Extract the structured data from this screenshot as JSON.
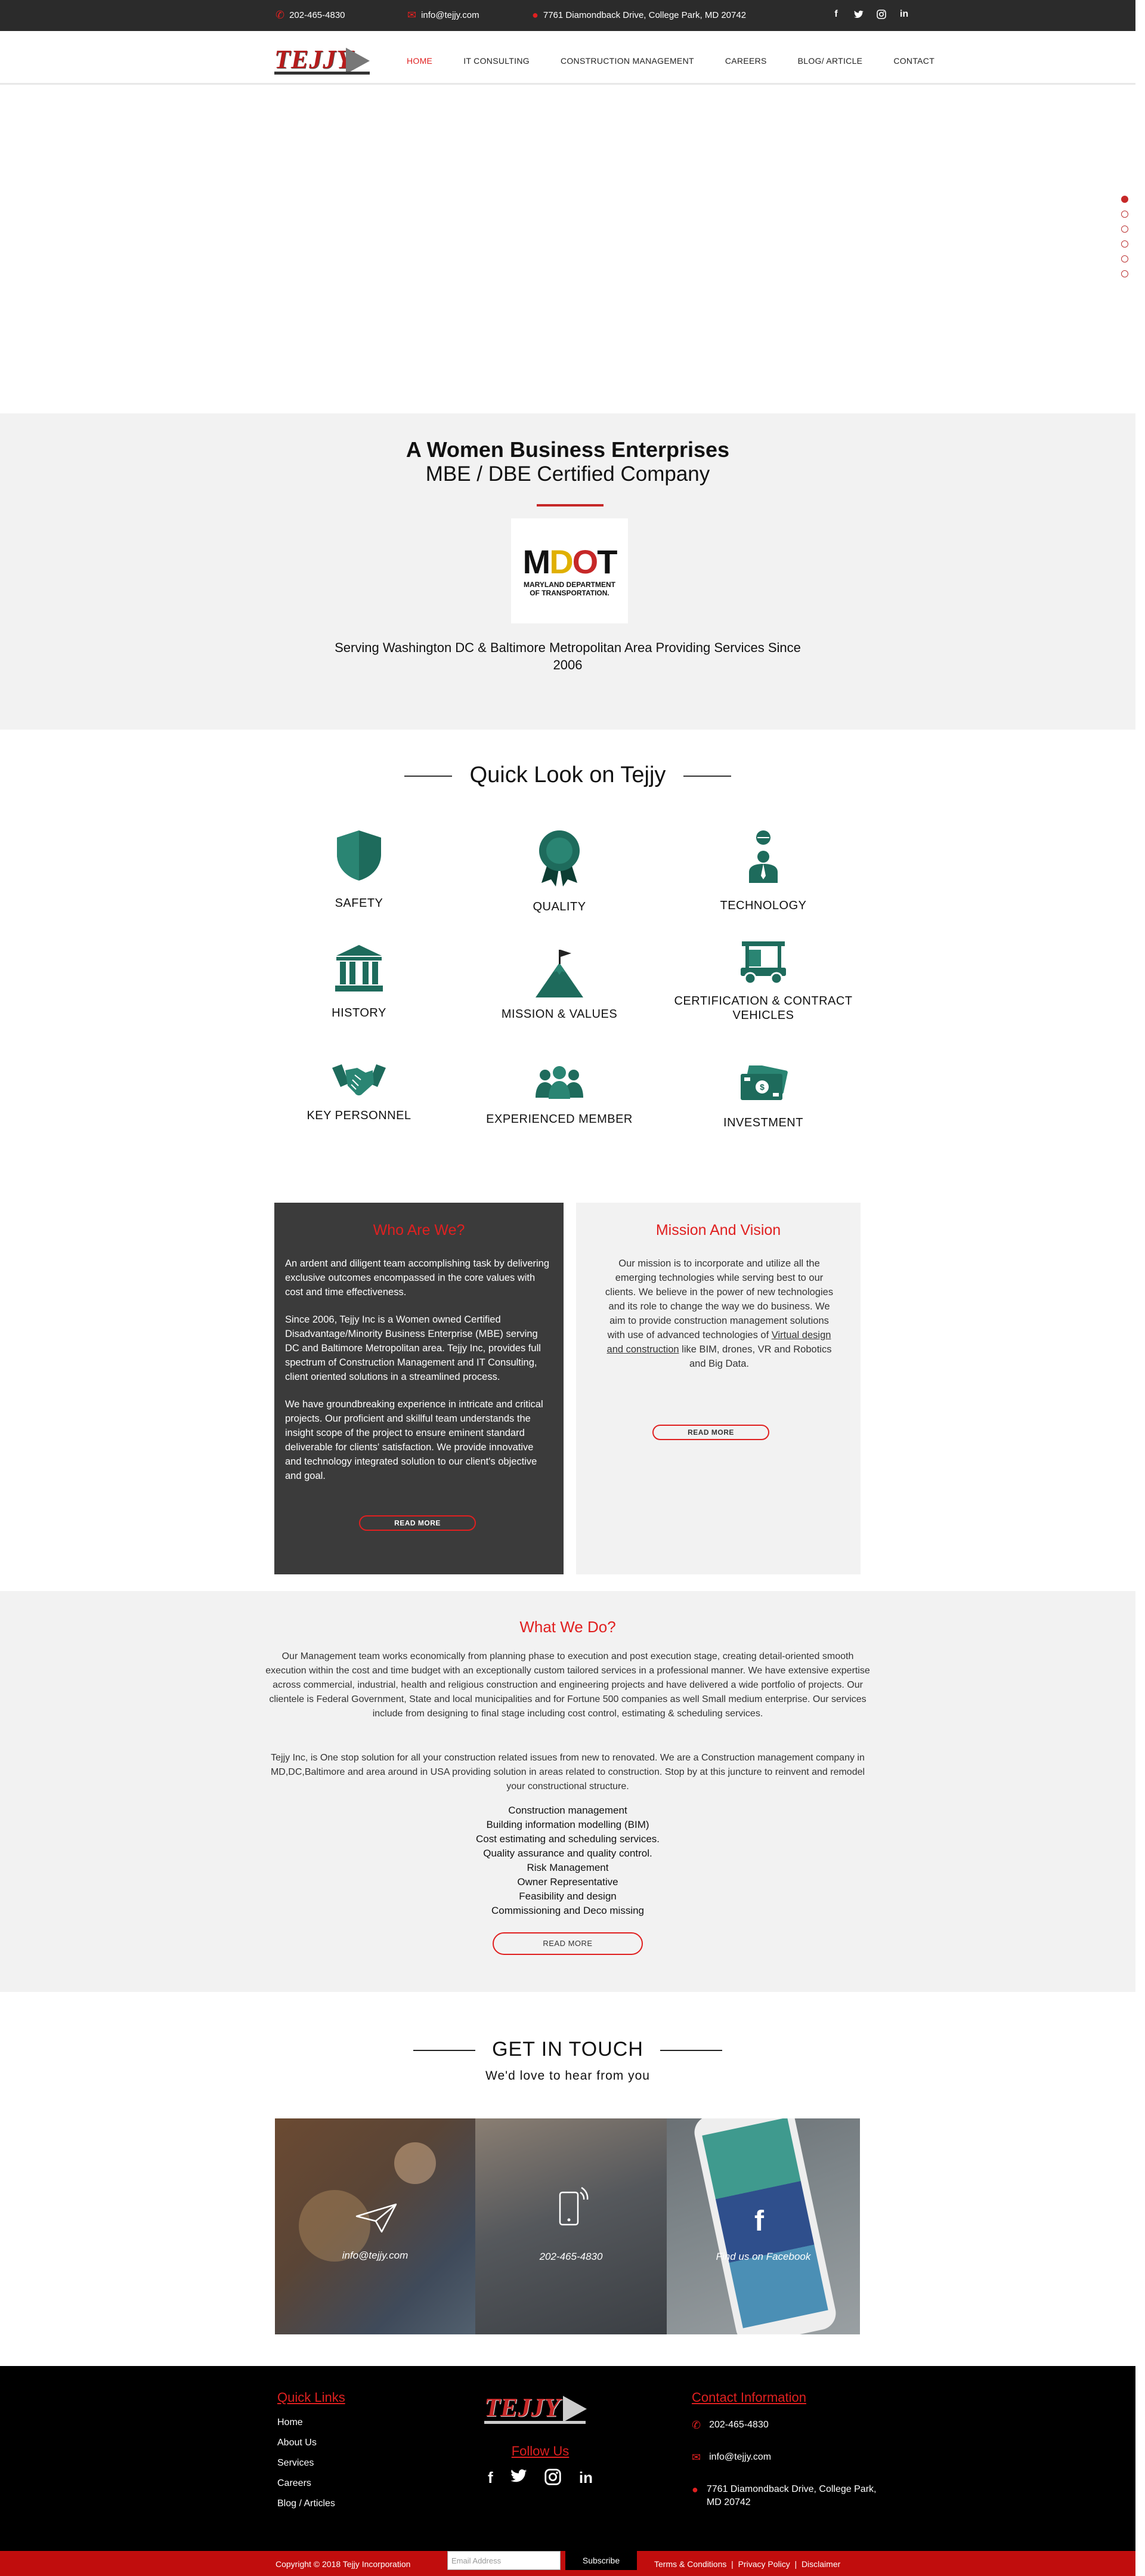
{
  "topbar": {
    "phone": "202-465-4830",
    "email": "info@tejjy.com",
    "address": "7761 Diamondback Drive, College Park, MD 20742",
    "social": [
      "facebook-icon",
      "twitter-icon",
      "instagram-icon",
      "linkedin-icon"
    ]
  },
  "nav": {
    "logo_text": "TEJJY",
    "items": [
      "HOME",
      "IT CONSULTING",
      "CONSTRUCTION MANAGEMENT",
      "CAREERS",
      "BLOG/ ARTICLE",
      "CONTACT"
    ],
    "active": "HOME"
  },
  "slider": {
    "slides": 6,
    "active_index": 0
  },
  "wbe": {
    "title": "A Women Business Enterprises",
    "subtitle": "MBE / DBE Certified Company",
    "mdot_logo": "MDOT",
    "mdot_line1": "MARYLAND DEPARTMENT",
    "mdot_line2": "OF TRANSPORTATION.",
    "serving": "Serving Washington DC & Baltimore Metropolitan Area Providing Services Since 2006"
  },
  "quicklook": {
    "title": "Quick Look on Tejjy",
    "items": [
      "SAFETY",
      "QUALITY",
      "TECHNOLOGY",
      "HISTORY",
      "MISSION & VALUES",
      "CERTIFICATION & CONTRACT VEHICLES",
      "KEY PERSONNEL",
      "EXPERIENCED MEMBER",
      "INVESTMENT"
    ]
  },
  "who": {
    "title": "Who Are We?",
    "p1": "An ardent and diligent team accomplishing task by delivering exclusive outcomes encompassed in the core values with cost and time effectiveness.",
    "p2": "Since 2006, Tejjy Inc is a Women owned Certified Disadvantage/Minority Business Enterprise (MBE) serving DC and Baltimore Metropolitan area. Tejjy Inc, provides full spectrum of Construction Management and IT Consulting,  client oriented solutions in a streamlined process.",
    "p3": "We have groundbreaking experience in intricate and critical projects. Our proficient and skillful team understands the insight scope of the project to ensure eminent standard deliverable for clients' satisfaction. We provide innovative and technology integrated solution to our client's objective and goal.",
    "button": "READ MORE"
  },
  "mission": {
    "title": "Mission And Vision",
    "text_before": "Our mission is to incorporate and utilize all the emerging technologies while serving best to our clients. We believe in the power of new technologies and its role to change the way we do business.  We aim to provide construction management solutions with use of advanced technologies of ",
    "link": "Virtual design and construction",
    "text_after": " like BIM, drones, VR and Robotics and Big Data.",
    "button": "READ MORE"
  },
  "wwd": {
    "title": "What We Do?",
    "p1": "Our Management team works economically from planning phase to execution and post execution stage, creating detail-oriented smooth execution within the cost and time budget with an exceptionally custom tailored services in a professional manner. We have extensive expertise across commercial, industrial, health and religious construction and engineering projects and have delivered a wide portfolio of projects. Our clientele is Federal Government, State and local municipalities and for Fortune 500 companies as well Small medium enterprise. Our services include from designing to final stage including cost control, estimating & scheduling services.",
    "p2": "Tejjy Inc, is One stop solution for all your construction related issues from new to renovated. We are a Construction management company in MD,DC,Baltimore and area around in USA providing solution in areas related to construction. Stop by at this juncture to reinvent and remodel your constructional structure.",
    "services": [
      "Construction management",
      "Building information modelling (BIM)",
      "Cost estimating and scheduling services.",
      "Quality assurance and quality control.",
      "Risk Management",
      "Owner Representative",
      "Feasibility and design",
      "Commissioning and Deco missing"
    ],
    "button": "READ MORE"
  },
  "touch": {
    "title": "GET IN TOUCH",
    "subtitle": "We'd love to hear from you",
    "email": "info@tejjy.com",
    "phone": "202-465-4830",
    "facebook": "Find us on Facebook"
  },
  "footer": {
    "quick_links_title": "Quick Links",
    "links": [
      "Home",
      "About Us",
      "Services",
      "Careers",
      "Blog / Articles"
    ],
    "logo_text": "TEJJY",
    "follow": "Follow Us",
    "contact_title": "Contact Information",
    "phone": "202-465-4830",
    "email": "info@tejjy.com",
    "address": "7761 Diamondback Drive, College Park, MD 20742",
    "copyright": "Copyright © 2018 Tejjy Incorporation",
    "email_placeholder": "Email Address",
    "subscribe": "Subscribe",
    "legal": [
      "Terms & Conditions",
      "Privacy Policy",
      "Disclaimer"
    ]
  },
  "colors": {
    "accent": "#e02020",
    "teal": "#1e6b5c",
    "dark": "#3b3b3b"
  }
}
